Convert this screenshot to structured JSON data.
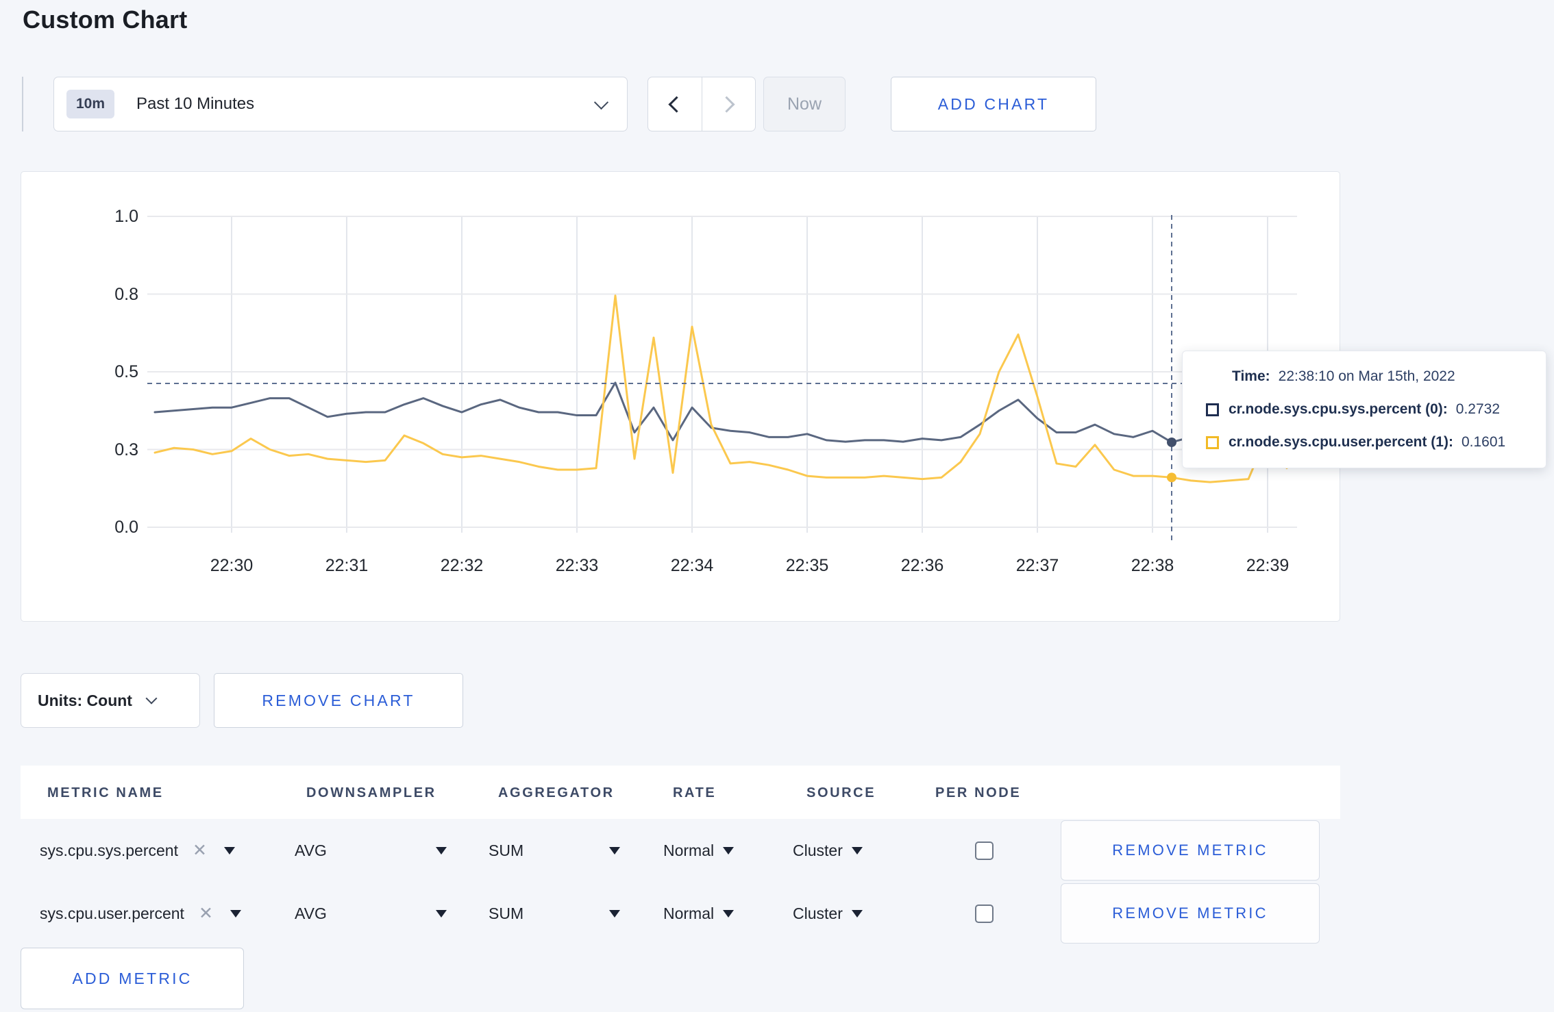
{
  "page": {
    "title": "Custom Chart"
  },
  "toolbar": {
    "time_badge": "10m",
    "time_label": "Past 10 Minutes",
    "now_label": "Now",
    "add_chart_label": "ADD CHART"
  },
  "chart_data": {
    "type": "line",
    "title": "",
    "xlabel": "",
    "ylabel": "",
    "ylim": [
      0,
      1
    ],
    "grid": true,
    "y_ticks": [
      {
        "value": 0,
        "label": "0.0"
      },
      {
        "value": 0.25,
        "label": "0.3"
      },
      {
        "value": 0.5,
        "label": "0.5"
      },
      {
        "value": 0.75,
        "label": "0.8"
      },
      {
        "value": 1,
        "label": "1.0"
      }
    ],
    "x_ticks": [
      "22:30",
      "22:31",
      "22:32",
      "22:33",
      "22:34",
      "22:35",
      "22:36",
      "22:37",
      "22:38",
      "22:39"
    ],
    "x": [
      "22:29:20",
      "22:29:30",
      "22:29:40",
      "22:29:50",
      "22:30:00",
      "22:30:10",
      "22:30:20",
      "22:30:30",
      "22:30:40",
      "22:30:50",
      "22:31:00",
      "22:31:10",
      "22:31:20",
      "22:31:30",
      "22:31:40",
      "22:31:50",
      "22:32:00",
      "22:32:10",
      "22:32:20",
      "22:32:30",
      "22:32:40",
      "22:32:50",
      "22:33:00",
      "22:33:10",
      "22:33:20",
      "22:33:30",
      "22:33:40",
      "22:33:50",
      "22:34:00",
      "22:34:10",
      "22:34:20",
      "22:34:30",
      "22:34:40",
      "22:34:50",
      "22:35:00",
      "22:35:10",
      "22:35:20",
      "22:35:30",
      "22:35:40",
      "22:35:50",
      "22:36:00",
      "22:36:10",
      "22:36:20",
      "22:36:30",
      "22:36:40",
      "22:36:50",
      "22:37:00",
      "22:37:10",
      "22:37:20",
      "22:37:30",
      "22:37:40",
      "22:37:50",
      "22:38:00",
      "22:38:10",
      "22:38:20",
      "22:38:30",
      "22:38:40",
      "22:38:50",
      "22:39:00",
      "22:39:10",
      "22:39:15"
    ],
    "series": [
      {
        "name": "cr.node.sys.cpu.sys.percent",
        "color": "#5a6780",
        "values": [
          0.37,
          0.375,
          0.38,
          0.385,
          0.385,
          0.4,
          0.415,
          0.415,
          0.385,
          0.355,
          0.365,
          0.37,
          0.37,
          0.395,
          0.415,
          0.39,
          0.37,
          0.395,
          0.41,
          0.385,
          0.37,
          0.37,
          0.36,
          0.36,
          0.465,
          0.305,
          0.385,
          0.28,
          0.385,
          0.32,
          0.31,
          0.305,
          0.29,
          0.29,
          0.3,
          0.28,
          0.275,
          0.28,
          0.28,
          0.275,
          0.285,
          0.28,
          0.29,
          0.33,
          0.375,
          0.41,
          0.35,
          0.305,
          0.305,
          0.33,
          0.3,
          0.29,
          0.31,
          0.2732,
          0.29,
          0.3,
          0.305,
          0.31,
          0.285,
          0.31,
          0.305
        ]
      },
      {
        "name": "cr.node.sys.cpu.user.percent",
        "color": "#fbc84e",
        "values": [
          0.24,
          0.255,
          0.25,
          0.235,
          0.245,
          0.285,
          0.25,
          0.23,
          0.235,
          0.22,
          0.215,
          0.21,
          0.215,
          0.295,
          0.27,
          0.235,
          0.225,
          0.23,
          0.22,
          0.21,
          0.195,
          0.185,
          0.185,
          0.19,
          0.745,
          0.22,
          0.61,
          0.175,
          0.645,
          0.33,
          0.205,
          0.21,
          0.2,
          0.185,
          0.165,
          0.16,
          0.16,
          0.16,
          0.165,
          0.16,
          0.155,
          0.16,
          0.21,
          0.3,
          0.5,
          0.62,
          0.42,
          0.205,
          0.195,
          0.265,
          0.185,
          0.165,
          0.165,
          0.1601,
          0.15,
          0.145,
          0.15,
          0.155,
          0.3,
          0.19,
          0.265
        ]
      }
    ]
  },
  "chart_ui": {
    "grid_h_color": "#e8e9ed",
    "grid_v_color": "#e3e6ec",
    "crosshair": {
      "time": "22:38:10",
      "cursor_value": 0.4626,
      "color": "#5d6f91",
      "points": [
        {
          "value": 0.2732,
          "color": "#42506c"
        },
        {
          "value": 0.1601,
          "color": "#f6bd33"
        }
      ]
    },
    "tooltip": {
      "time_label": "Time:",
      "time_value": "22:38:10 on Mar 15th, 2022",
      "rows": [
        {
          "swatch": "#1e2d50",
          "label": "cr.node.sys.cpu.sys.percent (0):",
          "value": "0.2732"
        },
        {
          "swatch": "#f2ba25",
          "label": "cr.node.sys.cpu.user.percent (1):",
          "value": "0.1601"
        }
      ]
    }
  },
  "units_row": {
    "units_label": "Units: Count",
    "remove_chart_label": "REMOVE CHART"
  },
  "metrics_table": {
    "headers": {
      "metric_name": "METRIC NAME",
      "downsampler": "DOWNSAMPLER",
      "aggregator": "AGGREGATOR",
      "rate": "RATE",
      "source": "SOURCE",
      "per_node": "PER NODE"
    },
    "close_glyph": "✕",
    "rows": [
      {
        "metric": "sys.cpu.sys.percent",
        "downsampler": "AVG",
        "aggregator": "SUM",
        "rate": "Normal",
        "source": "Cluster",
        "per_node_checked": false,
        "remove_label": "REMOVE METRIC"
      },
      {
        "metric": "sys.cpu.user.percent",
        "downsampler": "AVG",
        "aggregator": "SUM",
        "rate": "Normal",
        "source": "Cluster",
        "per_node_checked": false,
        "remove_label": "REMOVE METRIC"
      }
    ],
    "add_metric_label": "ADD METRIC"
  }
}
